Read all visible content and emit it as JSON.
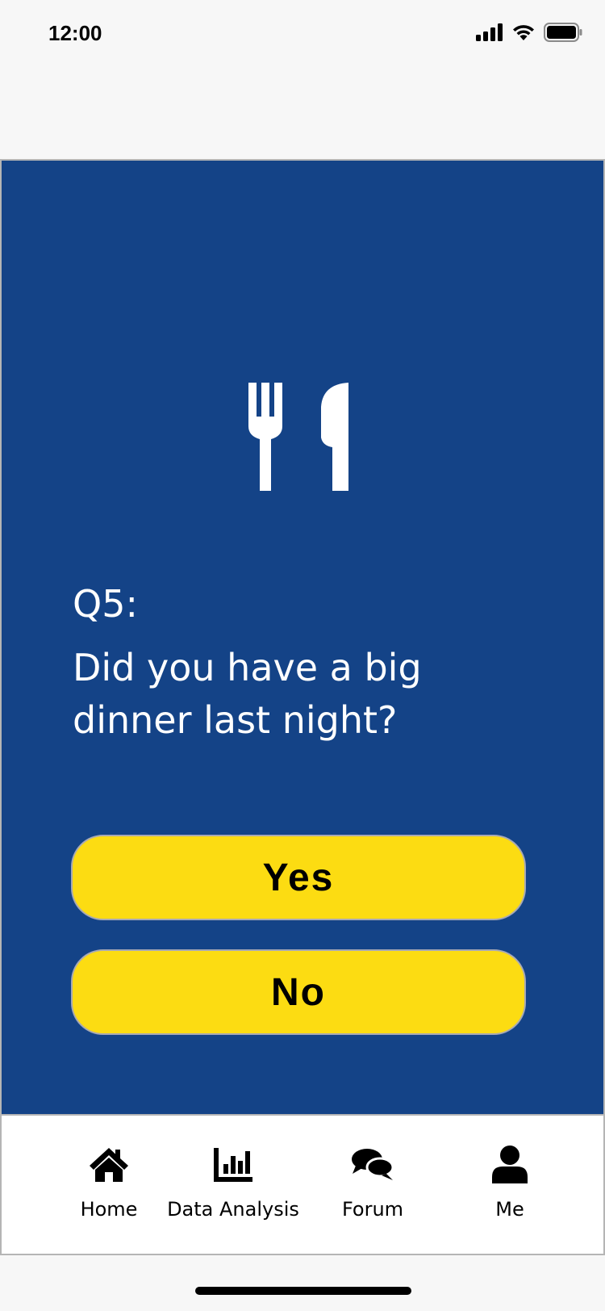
{
  "status_bar": {
    "time": "12:00"
  },
  "question": {
    "icon": "fork-knife-icon",
    "number": "Q5:",
    "text": "Did you have a big dinner last night?"
  },
  "answers": {
    "yes_label": "Yes",
    "no_label": "No"
  },
  "nav": {
    "items": [
      {
        "label": "Home",
        "icon": "home-icon"
      },
      {
        "label": "Data Analysis",
        "icon": "bar-chart-icon"
      },
      {
        "label": "Forum",
        "icon": "chat-bubbles-icon"
      },
      {
        "label": "Me",
        "icon": "user-icon"
      }
    ]
  },
  "colors": {
    "panel_background": "#144387",
    "button_background": "#fcdc12",
    "page_background": "#f7f7f7"
  }
}
